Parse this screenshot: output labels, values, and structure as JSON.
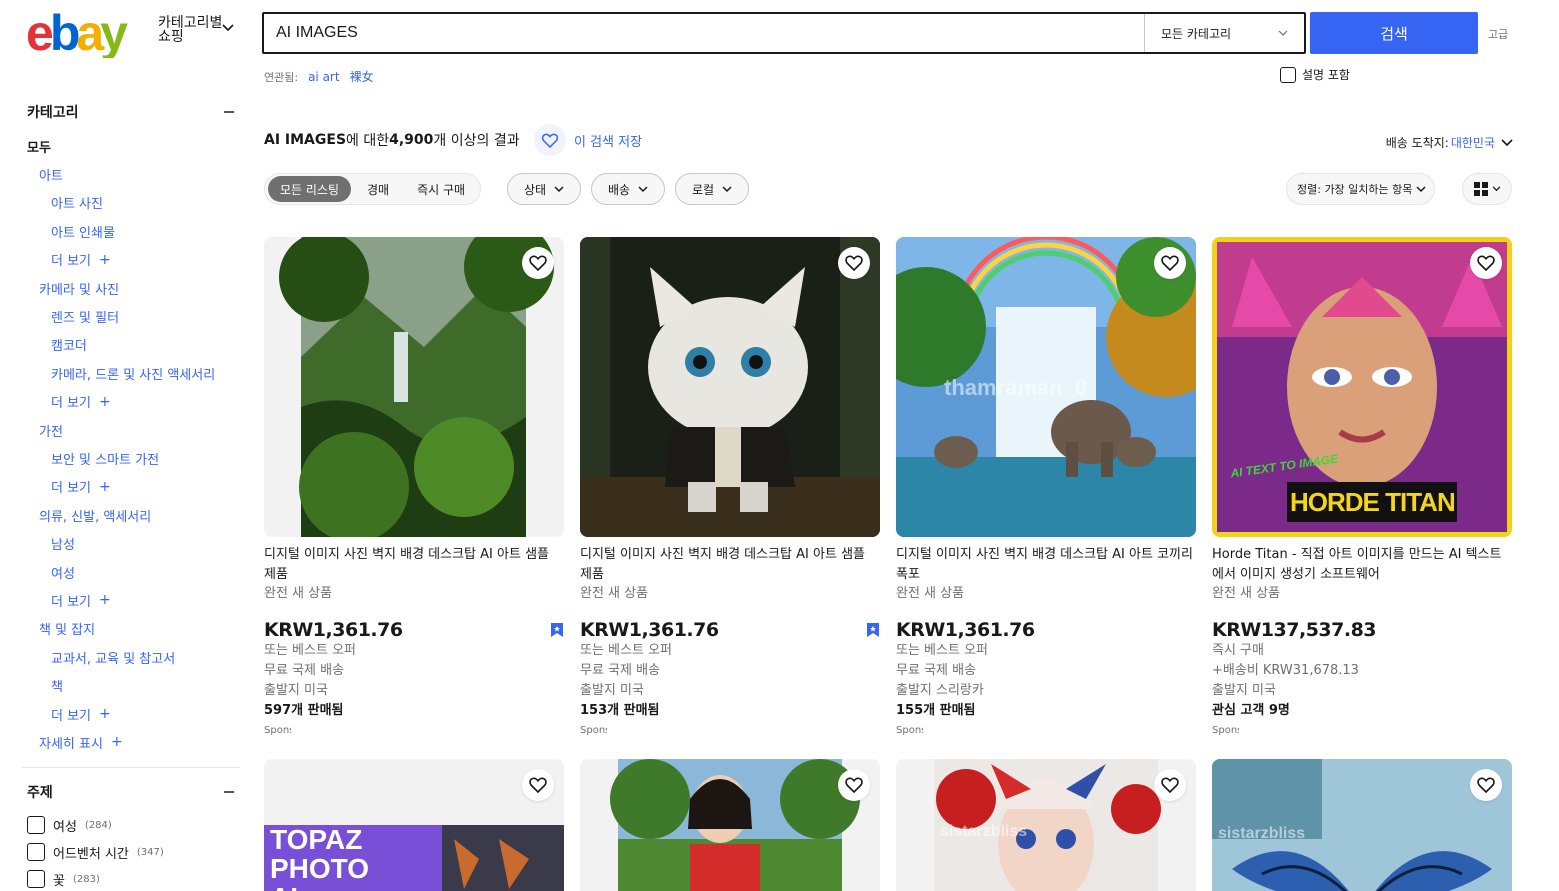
{
  "header": {
    "logo_text": "ebay",
    "shop_by_category": "카테고리별 쇼핑",
    "search_value": "AI IMAGES",
    "category_select": "모든 카테고리",
    "search_button": "검색",
    "advanced": "고급",
    "related_label": "연관됨:",
    "related_links": [
      "ai art",
      "裸女"
    ],
    "include_description": "설명 포함"
  },
  "sidebar": {
    "category_heading": "카테고리",
    "all": "모두",
    "items": [
      {
        "level": 1,
        "label": "아트"
      },
      {
        "level": 2,
        "label": "아트 사진"
      },
      {
        "level": 2,
        "label": "아트 인쇄물"
      },
      {
        "level": 2,
        "label": "더 보기",
        "more": true
      },
      {
        "level": 1,
        "label": "카메라 및 사진"
      },
      {
        "level": 2,
        "label": "렌즈 및 필터"
      },
      {
        "level": 2,
        "label": "캠코더"
      },
      {
        "level": 2,
        "label": "카메라, 드론 및 사진 액세서리"
      },
      {
        "level": 2,
        "label": "더 보기",
        "more": true
      },
      {
        "level": 1,
        "label": "가전"
      },
      {
        "level": 2,
        "label": "보안 및 스마트 가전"
      },
      {
        "level": 2,
        "label": "더 보기",
        "more": true
      },
      {
        "level": 1,
        "label": "의류, 신발, 액세서리"
      },
      {
        "level": 2,
        "label": "남성"
      },
      {
        "level": 2,
        "label": "여성"
      },
      {
        "level": 2,
        "label": "더 보기",
        "more": true
      },
      {
        "level": 1,
        "label": "책 및 잡지"
      },
      {
        "level": 2,
        "label": "교과서, 교육 및 참고서"
      },
      {
        "level": 2,
        "label": "책"
      },
      {
        "level": 2,
        "label": "더 보기",
        "more": true
      },
      {
        "level": 1,
        "label": "자세히 표시",
        "more": true
      }
    ],
    "topic_heading": "주제",
    "topics": [
      {
        "label": "여성",
        "count": "(284)"
      },
      {
        "label": "어드벤처 시간",
        "count": "(347)"
      },
      {
        "label": "꽃",
        "count": "(283)"
      }
    ]
  },
  "results": {
    "query": "AI IMAGES",
    "count_text_1": "에 대한 ",
    "count": "4,900",
    "count_text_2": "개 이상의 결과",
    "save_search": "이 검색 저장",
    "ship_to_label": "배송 도착지:",
    "ship_to_value": "대한민국"
  },
  "filters": {
    "tabs": [
      "모든 리스팅",
      "경매",
      "즉시 구매"
    ],
    "dropdowns": [
      "상태",
      "배송",
      "로컬"
    ],
    "sort": "정렬: 가장 일치하는 항목"
  },
  "listings": [
    {
      "title": "디지털 이미지 사진 벽지 배경 데스크탑 AI 아트 샘플 제품",
      "condition": "완전 새 상품",
      "price": "KRW1,361.76",
      "line1": "또는 베스트 오퍼",
      "line2": "무료 국제 배송",
      "line3": "출발지 미국",
      "sold": "597개 판매됨",
      "sponsored": "Sponsored"
    },
    {
      "title": "디지털 이미지 사진 벽지 배경 데스크탑 AI 아트 샘플 제품",
      "condition": "완전 새 상품",
      "price": "KRW1,361.76",
      "line1": "또는 베스트 오퍼",
      "line2": "무료 국제 배송",
      "line3": "출발지 미국",
      "sold": "153개 판매됨",
      "sponsored": "Sponsored"
    },
    {
      "title": "디지털 이미지 사진 벽지 배경 데스크탑 AI 아트 코끼리 폭포",
      "condition": "완전 새 상품",
      "price": "KRW1,361.76",
      "line1": "또는 베스트 오퍼",
      "line2": "무료 국제 배송",
      "line3": "출발지 스리랑카",
      "sold": "155개 판매됨",
      "sponsored": "Sponsored",
      "watermark": "thamraman_0"
    },
    {
      "title": "Horde Titan - 직접 아트 이미지를 만드는 AI 텍스트에서 이미지 생성기 소프트웨어",
      "condition": "완전 새 상품",
      "price": "KRW137,537.83",
      "line1": "즉시 구매",
      "line2": "+배송비 KRW31,678.13",
      "line3": "출발지 미국",
      "sold": "관심 고객 9명",
      "sponsored": "Sponsored",
      "img_text_top": "AI TEXT TO IMAGE",
      "img_text_main": "HORDE TITAN"
    }
  ],
  "bottom_listings": [
    {
      "img_text": "TOPAZ PHOTO AI"
    },
    {},
    {
      "watermark": "sistarzbliss"
    },
    {
      "watermark": "sistarzbliss"
    }
  ],
  "colors": {
    "accent": "#3665f3",
    "text": "#191919",
    "muted": "#707070"
  }
}
